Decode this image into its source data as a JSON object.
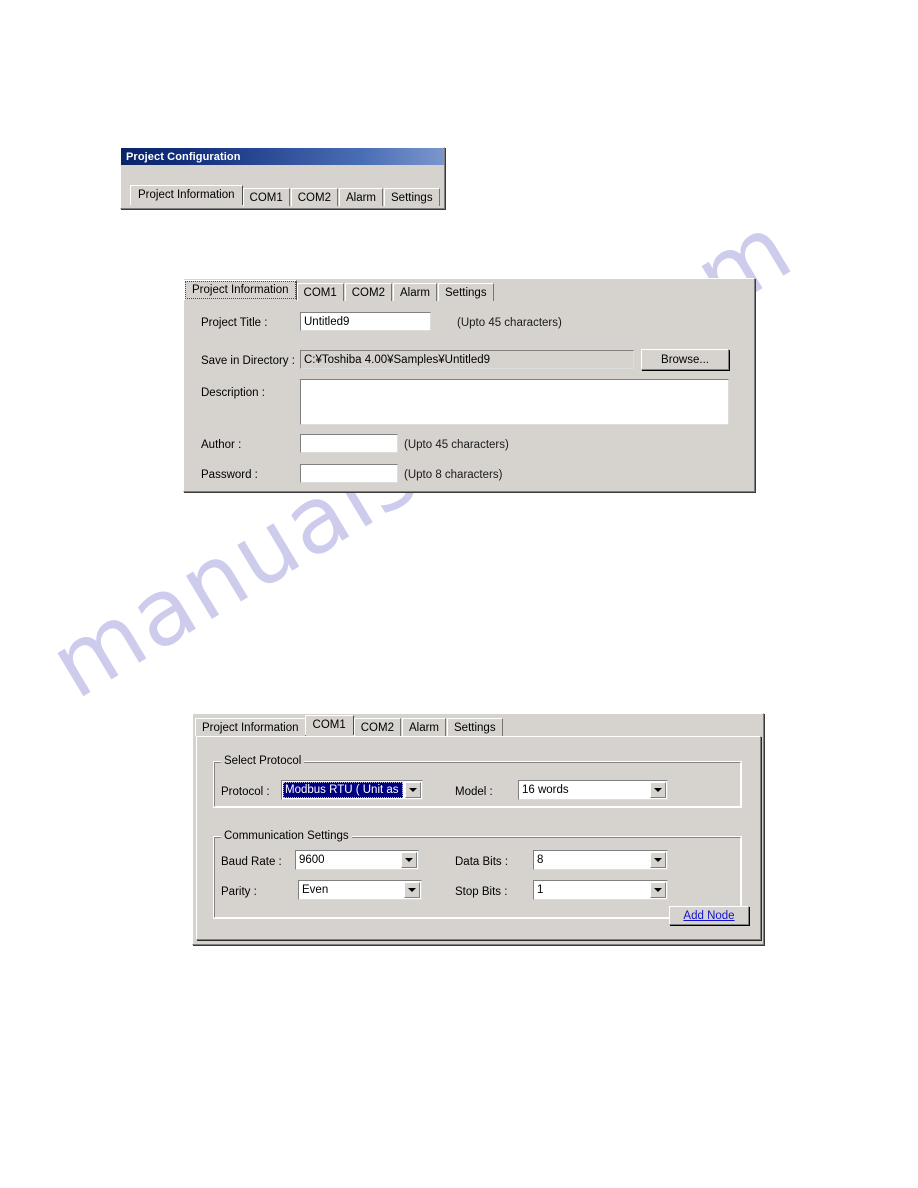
{
  "watermark": {
    "text": "manualshive.com"
  },
  "panel_project_configuration": {
    "window_title": "Project Configuration",
    "tabs": [
      {
        "label": "Project Information",
        "selected": true
      },
      {
        "label": "COM1",
        "selected": false
      },
      {
        "label": "COM2",
        "selected": false
      },
      {
        "label": "Alarm",
        "selected": false
      },
      {
        "label": "Settings",
        "selected": false
      }
    ]
  },
  "panel_project_information": {
    "tabs": [
      {
        "label": "Project Information",
        "selected": true
      },
      {
        "label": "COM1",
        "selected": false
      },
      {
        "label": "COM2",
        "selected": false
      },
      {
        "label": "Alarm",
        "selected": false
      },
      {
        "label": "Settings",
        "selected": false
      }
    ],
    "fields": {
      "project_title_label": "Project Title :",
      "project_title_value": "Untitled9",
      "project_title_hint": "(Upto 45 characters)",
      "save_in_directory_label": "Save in Directory :",
      "save_in_directory_value": "C:¥Toshiba 4.00¥Samples¥Untitled9",
      "browse_button": "Browse...",
      "description_label": "Description :",
      "description_value": "",
      "author_label": "Author :",
      "author_value": "",
      "author_hint": "(Upto 45 characters)",
      "password_label": "Password :",
      "password_value": "",
      "password_hint": "(Upto 8 characters)"
    }
  },
  "panel_com1": {
    "tabs": [
      {
        "label": "Project Information",
        "selected": false
      },
      {
        "label": "COM1",
        "selected": true
      },
      {
        "label": "COM2",
        "selected": false
      },
      {
        "label": "Alarm",
        "selected": false
      },
      {
        "label": "Settings",
        "selected": false
      }
    ],
    "select_protocol": {
      "group_title": "Select Protocol",
      "protocol_label": "Protocol :",
      "protocol_value": "Modbus RTU ( Unit as M",
      "model_label": "Model :",
      "model_value": "16 words"
    },
    "communication_settings": {
      "group_title": "Communication Settings",
      "baud_rate_label": "Baud Rate :",
      "baud_rate_value": "9600",
      "data_bits_label": "Data Bits :",
      "data_bits_value": "8",
      "parity_label": "Parity :",
      "parity_value": "Even",
      "stop_bits_label": "Stop Bits :",
      "stop_bits_value": "1",
      "add_node_button": "Add Node"
    }
  },
  "colors": {
    "face": "#d6d3ce",
    "titlebar_start": "#0a246a",
    "titlebar_end": "#7b96cc",
    "selection": "#000080",
    "link": "#1111cc",
    "watermark": "#c6c4ea"
  }
}
